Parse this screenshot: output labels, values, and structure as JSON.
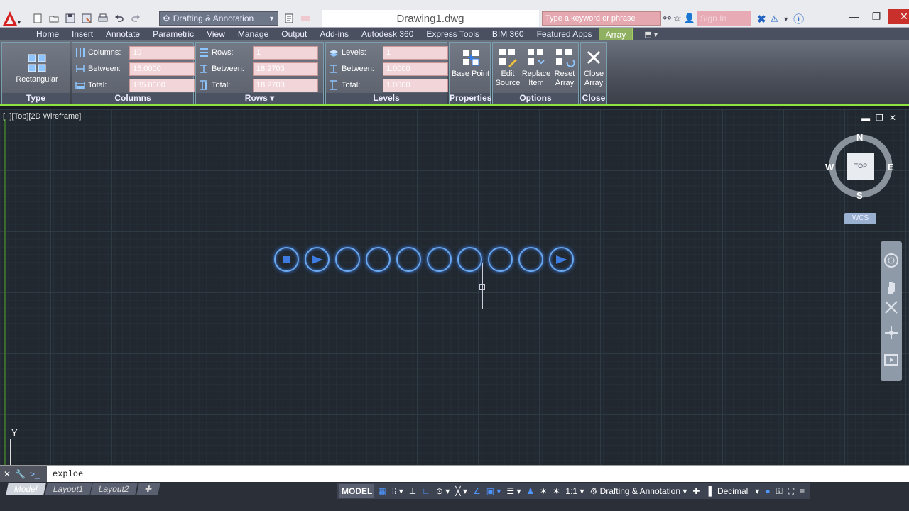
{
  "title_bar": {
    "workspace": "Drafting & Annotation",
    "document_title": "Drawing1.dwg",
    "search_placeholder": "Type a keyword or phrase",
    "signin_label": "Sign In"
  },
  "ribbon_tabs": [
    "Home",
    "Insert",
    "Annotate",
    "Parametric",
    "View",
    "Manage",
    "Output",
    "Add-ins",
    "Autodesk 360",
    "Express Tools",
    "BIM 360",
    "Featured Apps",
    "Array"
  ],
  "active_tab": "Array",
  "ribbon": {
    "type_panel": {
      "title": "Type",
      "button": "Rectangular"
    },
    "columns_panel": {
      "title": "Columns",
      "columns_label": "Columns:",
      "columns_value": "10",
      "between_label": "Between:",
      "between_value": "15.0000",
      "total_label": "Total:",
      "total_value": "135.0000"
    },
    "rows_panel": {
      "title": "Rows",
      "rows_label": "Rows:",
      "rows_value": "1",
      "between_label": "Between:",
      "between_value": "18.2703",
      "total_label": "Total:",
      "total_value": "18.2703"
    },
    "levels_panel": {
      "title": "Levels",
      "levels_label": "Levels:",
      "levels_value": "1",
      "between_label": "Between:",
      "between_value": "1.0000",
      "total_label": "Total:",
      "total_value": "1.0000"
    },
    "properties_panel": {
      "title": "Properties",
      "button": "Base Point"
    },
    "options_panel": {
      "title": "Options",
      "edit_source": "Edit Source",
      "replace_item": "Replace Item",
      "reset_array": "Reset Array"
    },
    "close_panel": {
      "title": "Close",
      "button": "Close Array"
    }
  },
  "viewport": {
    "label": "[−][Top][2D Wireframe]",
    "viewcube_face": "TOP",
    "compass": {
      "n": "N",
      "s": "S",
      "e": "E",
      "w": "W"
    },
    "wcs": "WCS",
    "ucs_y": "Y",
    "array_count": 10
  },
  "command_line": {
    "input": "exploe"
  },
  "layout_tabs": [
    "Model",
    "Layout1",
    "Layout2"
  ],
  "status_bar": {
    "model": "MODEL",
    "scale": "1:1",
    "workspace": "Drafting & Annotation",
    "units": "Decimal"
  },
  "colors": {
    "accent_green": "#8de23f",
    "array_blue": "#6aa8f0",
    "canvas_bg": "#212830"
  }
}
